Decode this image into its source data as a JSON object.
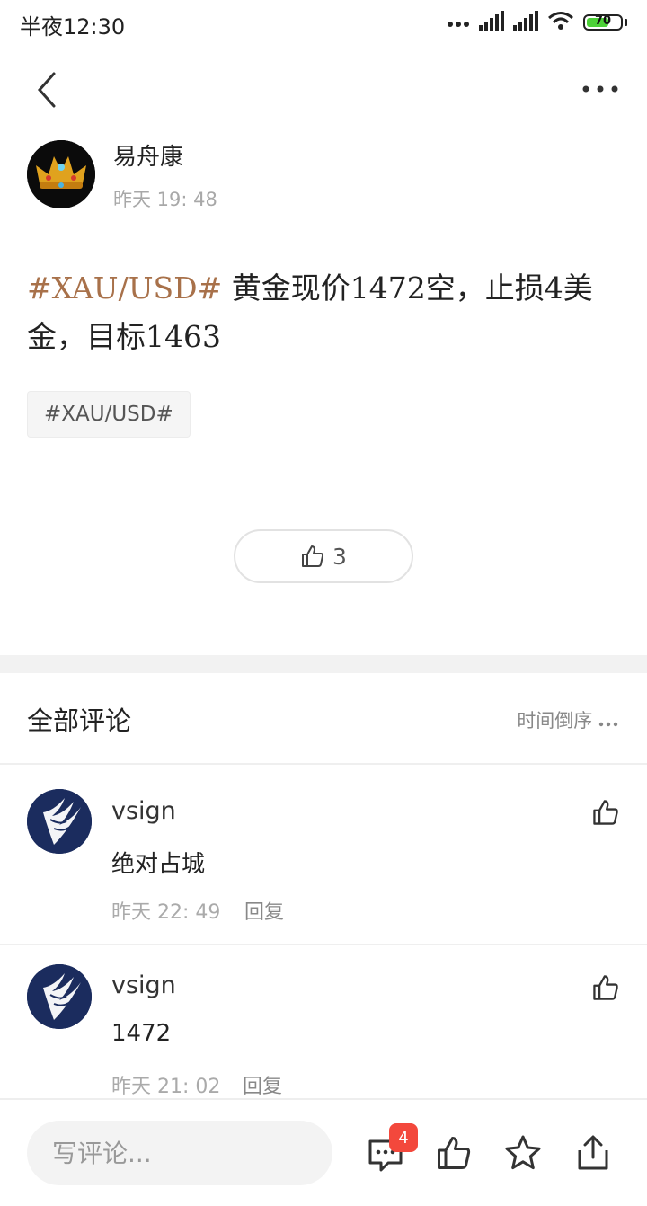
{
  "status_bar": {
    "time": "半夜12:30",
    "battery": "70",
    "battery_level": 0.7
  },
  "post": {
    "author": "易舟康",
    "time": "昨天 19: 48",
    "hashtag": "#XAU/USD#",
    "text": " 黄金现价1472空，止损4美金，目标1463",
    "tag": "#XAU/USD#",
    "likes": "3"
  },
  "comments_section": {
    "title": "全部评论",
    "sort_label": "时间倒序",
    "items": [
      {
        "user": "vsign",
        "text": "绝对占城",
        "time": "昨天 22: 49",
        "reply_label": "回复"
      },
      {
        "user": "vsign",
        "text": "1472",
        "time": "昨天 21: 02",
        "reply_label": "回复"
      }
    ]
  },
  "bottom_bar": {
    "input_placeholder": "写评论...",
    "comment_badge": "4"
  },
  "colors": {
    "hashtag": "#a8714a",
    "badge": "#f3483c",
    "avatar_blue": "#1b2c5e",
    "battery_green": "#4cd137"
  }
}
